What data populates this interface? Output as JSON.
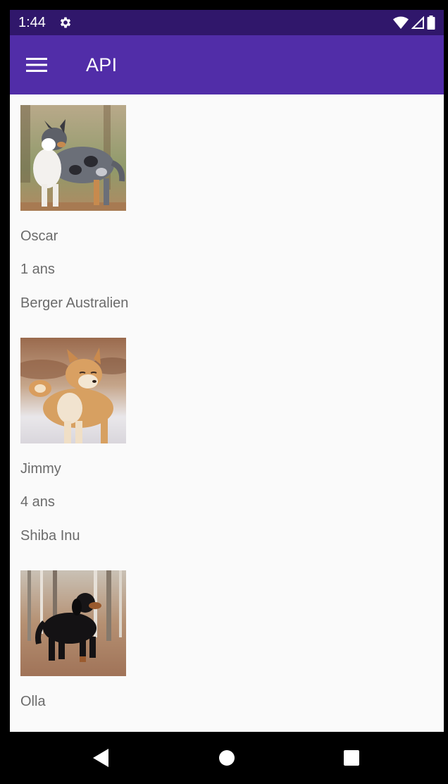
{
  "status_bar": {
    "time": "1:44",
    "icons": [
      "gear-icon",
      "wifi-icon",
      "signal-icon",
      "battery-icon"
    ]
  },
  "app_bar": {
    "title": "API",
    "menu_icon": "hamburger-menu-icon"
  },
  "dogs": [
    {
      "name": "Oscar",
      "age": "1 ans",
      "breed": "Berger Australien",
      "photo": "australian-shepherd-photo"
    },
    {
      "name": "Jimmy",
      "age": "4 ans",
      "breed": "Shiba Inu",
      "photo": "shiba-inu-photo"
    },
    {
      "name": "Olla",
      "age": "",
      "breed": "",
      "photo": "black-dog-photo"
    }
  ],
  "nav_bar": {
    "icons": [
      "back-icon",
      "home-icon",
      "recents-icon"
    ]
  },
  "colors": {
    "status_bar": "#30176b",
    "app_bar": "#512da8",
    "background": "#fafafa",
    "text_secondary": "#6b6b6b"
  }
}
